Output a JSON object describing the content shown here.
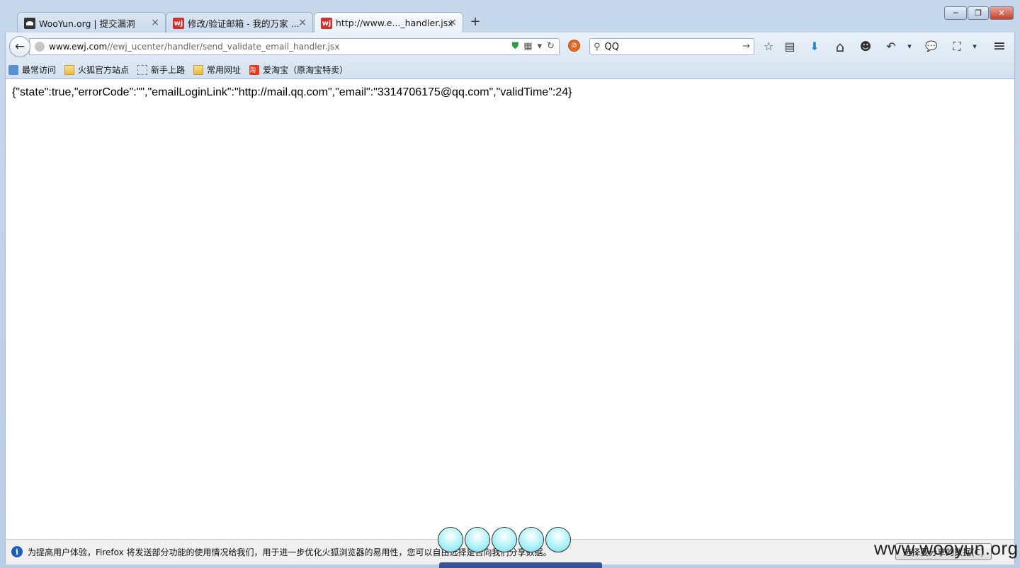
{
  "tabs": [
    {
      "title": "WooYun.org | 提交漏洞",
      "favicon": "wooyun-icon"
    },
    {
      "title": "修改/验证邮箱 - 我的万家 ...",
      "favicon": "ewj-icon"
    },
    {
      "title": "http://www.e..._handler.jsx",
      "favicon": "ewj-icon"
    }
  ],
  "new_tab": "+",
  "close_glyph": "×",
  "favicon_ewj_text": "wj",
  "window_controls": {
    "minimize": "─",
    "maximize": "❐",
    "close": "✕"
  },
  "nav": {
    "back": "←",
    "url_domain": "www.ewj.com",
    "url_path": "//ewj_ucenter/handler/send_validate_email_handler.jsx",
    "search_value": "QQ",
    "search_go": "→",
    "reload": "↻",
    "dropdown": "▾"
  },
  "toolbar_icons": [
    "star-icon",
    "reading-list-icon",
    "download-icon",
    "home-icon",
    "smiley-icon",
    "undo-icon",
    "chat-icon",
    "crop-icon",
    "menu-icon"
  ],
  "toolbar_glyphs": {
    "star": "☆",
    "reading": "▤",
    "download": "⬇",
    "home": "⌂",
    "smiley": "☻",
    "undo": "↶",
    "chat": "💬",
    "crop": "⛶",
    "dropdown": "▾",
    "menu": "≡"
  },
  "bookmarks": [
    {
      "label": "最常访问",
      "icon": "most-visited-icon"
    },
    {
      "label": "火狐官方站点",
      "icon": "folder-icon"
    },
    {
      "label": "新手上路",
      "icon": "dashed-folder-icon"
    },
    {
      "label": "常用网址",
      "icon": "folder-icon"
    },
    {
      "label": "爱淘宝（原淘宝特卖）",
      "icon": "taobao-icon"
    }
  ],
  "taobao_icon_text": "淘",
  "content": {
    "json_text": "{\"state\":true,\"errorCode\":\"\",\"emailLoginLink\":\"http://mail.qq.com\",\"email\":\"3314706175@qq.com\",\"validTime\":24}"
  },
  "notification": {
    "message": "为提高用户体验，Firefox 将发送部分功能的使用情况给我们，用于进一步优化火狐浏览器的易用性，您可以自由选择是否向我们分享数据。",
    "button": "选择要分享的数据(C)",
    "info_glyph": "i"
  },
  "watermark": "www.wooyun.org",
  "colors": {
    "accent": "#1e8ad6",
    "close_red": "#c5412b",
    "ewj_red": "#d32f2f"
  }
}
